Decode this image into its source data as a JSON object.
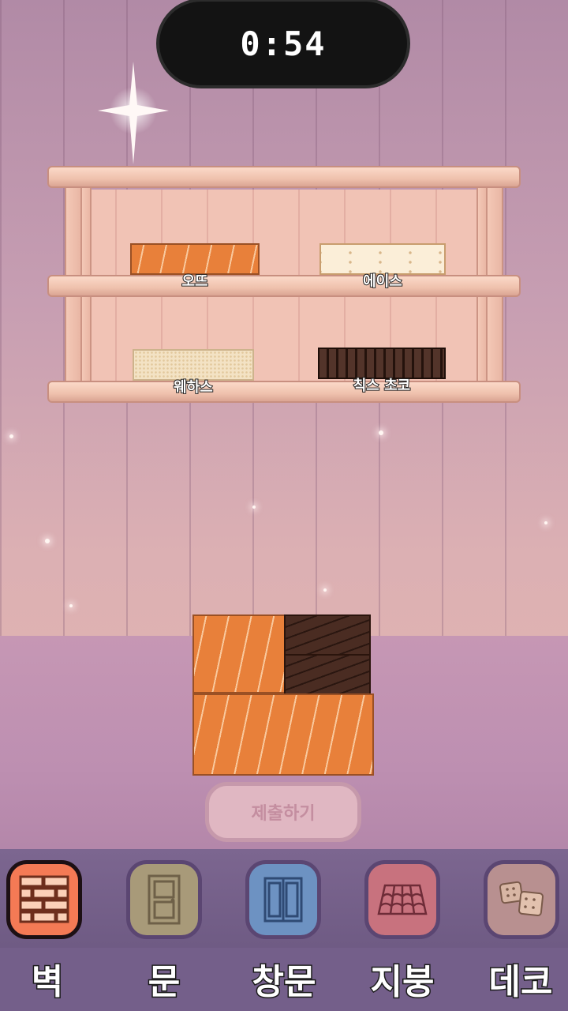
{
  "timer": {
    "text": "0:54"
  },
  "shelf": {
    "items": [
      {
        "label": "오뜨",
        "texture": "oat-cookie"
      },
      {
        "label": "에이스",
        "texture": "ace-cracker"
      },
      {
        "label": "웨하스",
        "texture": "wafer"
      },
      {
        "label": "칙스 초코",
        "texture": "chocolate-stick"
      }
    ]
  },
  "submit": {
    "label": "제출하기",
    "enabled": false
  },
  "toolbar": {
    "tabs": [
      {
        "label": "벽",
        "icon": "brick-wall-icon",
        "color": "#f47a55",
        "active": true
      },
      {
        "label": "문",
        "icon": "door-icon",
        "color": "#a89a79",
        "active": false
      },
      {
        "label": "창문",
        "icon": "window-icon",
        "color": "#6d92c2",
        "active": false
      },
      {
        "label": "지붕",
        "icon": "roof-tile-icon",
        "color": "#c8727e",
        "active": false
      },
      {
        "label": "데코",
        "icon": "cracker-deco-icon",
        "color": "#b89090",
        "active": false
      }
    ]
  },
  "colors": {
    "oat": "#e8803a",
    "chocolate": "#4a2c22",
    "wood": "#f1c3b5"
  }
}
